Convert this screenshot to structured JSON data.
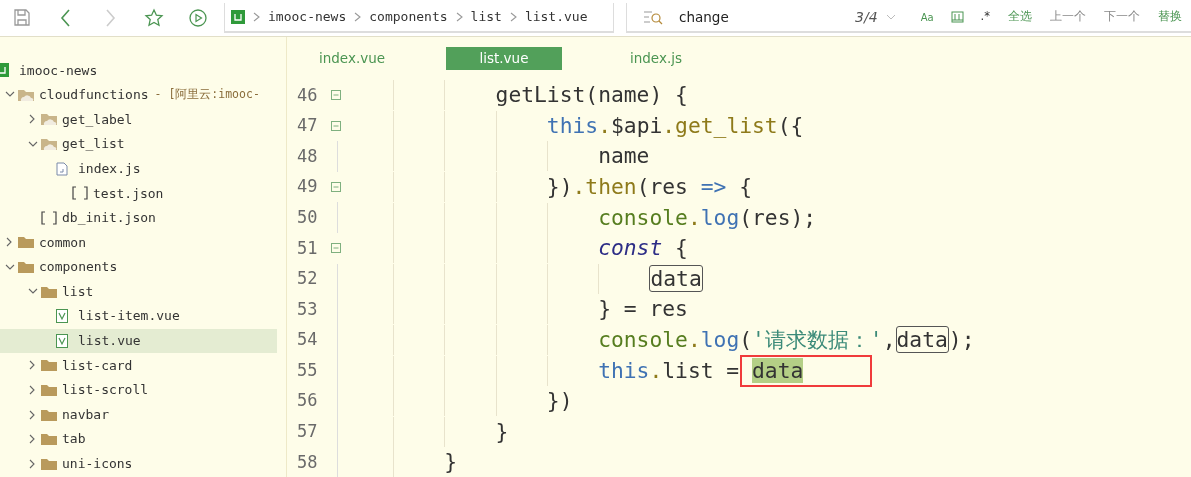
{
  "toolbar": {
    "buttons": [
      {
        "kind": "save",
        "disabled": false
      },
      {
        "kind": "back",
        "disabled": false
      },
      {
        "kind": "forward",
        "disabled": true
      },
      {
        "kind": "star",
        "disabled": false
      },
      {
        "kind": "run",
        "disabled": false
      }
    ],
    "breadcrumb": [
      "imooc-news",
      "components",
      "list",
      "list.vue"
    ]
  },
  "search": {
    "value": "change",
    "count": "3/4",
    "case_label": "Aa",
    "regex_label": ".*",
    "actions": [
      {
        "label": "全选",
        "disabled": false
      },
      {
        "label": "上一个",
        "disabled": true
      },
      {
        "label": "下一个",
        "disabled": true
      },
      {
        "label": "替换",
        "disabled": false
      }
    ]
  },
  "project": {
    "name": "imooc-news"
  },
  "tree": [
    {
      "label": "cloudfunctions",
      "suffix": "- [阿里云:imooc-",
      "kind": "cloud-folder",
      "expanded": true,
      "selected": false,
      "children": [
        {
          "label": "get_label",
          "kind": "cloud-folder",
          "expanded": false,
          "selected": false
        },
        {
          "label": "get_list",
          "kind": "cloud-folder",
          "expanded": true,
          "selected": false,
          "children": [
            {
              "label": "index.js",
              "kind": "js",
              "selected": false
            },
            {
              "label": "test.json",
              "kind": "json",
              "selected": false
            }
          ]
        },
        {
          "label": "db_init.json",
          "kind": "json",
          "selected": false
        }
      ]
    },
    {
      "label": "common",
      "kind": "folder",
      "expanded": false,
      "selected": false
    },
    {
      "label": "components",
      "kind": "folder",
      "expanded": true,
      "selected": false,
      "children": [
        {
          "label": "list",
          "kind": "folder",
          "expanded": true,
          "selected": false,
          "children": [
            {
              "label": "list-item.vue",
              "kind": "vue",
              "selected": false
            },
            {
              "label": "list.vue",
              "kind": "vue",
              "selected": true
            }
          ]
        },
        {
          "label": "list-card",
          "kind": "folder",
          "expanded": false,
          "selected": false
        },
        {
          "label": "list-scroll",
          "kind": "folder",
          "expanded": false,
          "selected": false
        },
        {
          "label": "navbar",
          "kind": "folder",
          "expanded": false,
          "selected": false
        },
        {
          "label": "tab",
          "kind": "folder",
          "expanded": false,
          "selected": false
        },
        {
          "label": "uni-icons",
          "kind": "folder",
          "expanded": false,
          "selected": false
        }
      ]
    }
  ],
  "tabs": [
    {
      "label": "index.vue",
      "selected": false
    },
    {
      "label": "list.vue",
      "selected": true
    },
    {
      "label": "index.js",
      "selected": false
    }
  ],
  "code": [
    {
      "children": [
        {
          "number": "46",
          "foldable": true,
          "marked": false,
          "tokens": [
            {
              "text": "getList(name) {",
              "kind": "plain"
            }
          ],
          "children": [
            {
              "number": "47",
              "foldable": true,
              "marked": false,
              "tokens": [
                {
                  "text": "this",
                  "kind": "keyword"
                },
                {
                  "text": ".",
                  "kind": "member"
                },
                {
                  "text": "$api",
                  "kind": "plain"
                },
                {
                  "text": ".get_list",
                  "kind": "member"
                },
                {
                  "text": "({",
                  "kind": "plain"
                }
              ],
              "children": [
                {
                  "number": "48",
                  "foldable": false,
                  "marked": false,
                  "tokens": [
                    {
                      "text": "name",
                      "kind": "plain"
                    }
                  ]
                }
              ]
            },
            {
              "number": "49",
              "foldable": true,
              "marked": false,
              "tokens": [
                {
                  "text": "})",
                  "kind": "plain"
                },
                {
                  "text": ".then",
                  "kind": "member"
                },
                {
                  "text": "(res ",
                  "kind": "plain"
                },
                {
                  "text": "=>",
                  "kind": "keyword"
                },
                {
                  "text": " {",
                  "kind": "plain"
                }
              ],
              "children": [
                {
                  "number": "50",
                  "foldable": false,
                  "marked": false,
                  "tokens": [
                    {
                      "text": "console",
                      "kind": "object"
                    },
                    {
                      "text": ".",
                      "kind": "member"
                    },
                    {
                      "text": "log",
                      "kind": "method"
                    },
                    {
                      "text": "(res);",
                      "kind": "plain"
                    }
                  ]
                },
                {
                  "number": "51",
                  "foldable": true,
                  "marked": false,
                  "tokens": [
                    {
                      "text": "const",
                      "kind": "storage"
                    },
                    {
                      "text": " {",
                      "kind": "plain"
                    }
                  ],
                  "children": [
                    {
                      "number": "52",
                      "foldable": false,
                      "marked": false,
                      "tokens": [
                        {
                          "text": "data",
                          "kind": "boxed"
                        }
                      ]
                    }
                  ]
                },
                {
                  "number": "53",
                  "foldable": false,
                  "marked": false,
                  "tokens": [
                    {
                      "text": "} = res",
                      "kind": "plain"
                    }
                  ]
                },
                {
                  "number": "54",
                  "foldable": false,
                  "marked": false,
                  "tokens": [
                    {
                      "text": "console",
                      "kind": "object"
                    },
                    {
                      "text": ".",
                      "kind": "member"
                    },
                    {
                      "text": "log",
                      "kind": "method"
                    },
                    {
                      "text": "(",
                      "kind": "plain"
                    },
                    {
                      "text": "'请求数据：'",
                      "kind": "string"
                    },
                    {
                      "text": ",",
                      "kind": "plain"
                    },
                    {
                      "text": "data",
                      "kind": "boxed"
                    },
                    {
                      "text": ");",
                      "kind": "plain"
                    }
                  ]
                },
                {
                  "number": "55",
                  "foldable": false,
                  "marked": true,
                  "tokens": [
                    {
                      "text": "this",
                      "kind": "keyword"
                    },
                    {
                      "text": ".",
                      "kind": "member"
                    },
                    {
                      "text": "list = ",
                      "kind": "plain"
                    },
                    {
                      "text": "data",
                      "kind": "match"
                    }
                  ]
                }
              ]
            },
            {
              "number": "56",
              "foldable": false,
              "marked": false,
              "tokens": [
                {
                  "text": "})",
                  "kind": "plain"
                }
              ]
            }
          ]
        },
        {
          "number": "57",
          "foldable": false,
          "marked": false,
          "tokens": [
            {
              "text": "}",
              "kind": "plain"
            }
          ]
        }
      ]
    },
    {
      "number": "58",
      "foldable": false,
      "marked": false,
      "tokens": [
        {
          "text": "}",
          "kind": "plain"
        }
      ]
    }
  ]
}
